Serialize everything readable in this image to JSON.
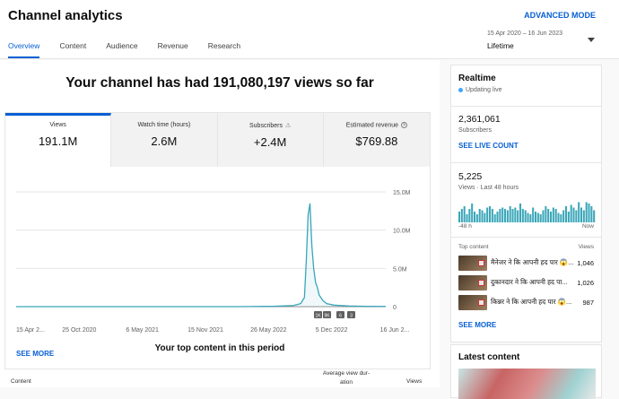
{
  "header": {
    "title": "Channel analytics",
    "advanced_mode": "ADVANCED MODE",
    "tabs": [
      {
        "label": "Overview",
        "active": true
      },
      {
        "label": "Content",
        "active": false
      },
      {
        "label": "Audience",
        "active": false
      },
      {
        "label": "Revenue",
        "active": false
      },
      {
        "label": "Research",
        "active": false
      }
    ],
    "date_range": "15 Apr 2020 – 16 Jun 2023",
    "date_selection": "Lifetime"
  },
  "main": {
    "headline": "Your channel has had 191,080,197 views so far",
    "metrics": [
      {
        "label": "Views",
        "value": "191.1M"
      },
      {
        "label": "Watch time (hours)",
        "value": "2.6M"
      },
      {
        "label": "Subscribers",
        "value": "+2.4M"
      },
      {
        "label": "Estimated revenue",
        "value": "$769.88"
      }
    ],
    "see_more": "SEE MORE",
    "top_content_title": "Your top content in this period",
    "table_headers": {
      "content": "Content",
      "avg_view_duration_1": "Average view dur-",
      "avg_view_duration_2": "ation",
      "views": "Views"
    }
  },
  "chart_data": {
    "type": "line",
    "x_tick_labels": [
      "15 Apr 2...",
      "25 Oct 2020",
      "6 May 2021",
      "15 Nov 2021",
      "26 May 2022",
      "5 Dec 2022",
      "16 Jun 2..."
    ],
    "y_tick_labels": [
      "15.0M",
      "10.0M",
      "5.0M",
      "0"
    ],
    "ylim": [
      0,
      15000000
    ],
    "series": [
      {
        "x_position": [
          0,
          0.1,
          0.2,
          0.3,
          0.4,
          0.5,
          0.6,
          0.7,
          0.75,
          0.77,
          0.78,
          0.785,
          0.79,
          0.795,
          0.8,
          0.805,
          0.81,
          0.815,
          0.82,
          0.83,
          0.84,
          0.86,
          0.9,
          0.95,
          1.0
        ],
        "values": [
          0,
          0,
          0,
          0,
          0,
          0,
          0,
          50000,
          150000,
          400000,
          1200000,
          6000000,
          12000000,
          13500000,
          8000000,
          5000000,
          3200000,
          2500000,
          1500000,
          800000,
          400000,
          200000,
          80000,
          40000,
          20000
        ]
      }
    ],
    "event_markers": [
      "1K",
      "9K",
      "6",
      "3"
    ],
    "color": "#3aa6b9"
  },
  "realtime": {
    "title": "Realtime",
    "status": "Updating live",
    "subscribers": "2,361,061",
    "subscribers_label": "Subscribers",
    "see_live_count": "SEE LIVE COUNT",
    "views": "5,225",
    "views_label": "Views · Last 48 hours",
    "bar_axis_start": "-48 h",
    "bar_axis_end": "Now",
    "bars": [
      0.4,
      0.5,
      0.6,
      0.3,
      0.5,
      0.7,
      0.4,
      0.3,
      0.5,
      0.45,
      0.35,
      0.55,
      0.6,
      0.5,
      0.3,
      0.4,
      0.5,
      0.55,
      0.5,
      0.45,
      0.6,
      0.5,
      0.55,
      0.45,
      0.7,
      0.5,
      0.45,
      0.35,
      0.3,
      0.55,
      0.4,
      0.35,
      0.3,
      0.45,
      0.6,
      0.5,
      0.4,
      0.55,
      0.5,
      0.35,
      0.3,
      0.45,
      0.6,
      0.4,
      0.65,
      0.55,
      0.45,
      0.75,
      0.55,
      0.45,
      0.75,
      0.7,
      0.6,
      0.45
    ],
    "top_content_label": "Top content",
    "views_col_label": "Views",
    "items": [
      {
        "title": "मैनेजर ने कि आपनी हद पार 😱...",
        "views": "1,046"
      },
      {
        "title": "दुकानदार ने कि आपनी हद पा...",
        "views": "1,026"
      },
      {
        "title": "किन्नर ने कि आपनी हद पार 😱...",
        "views": "987"
      }
    ],
    "see_more": "SEE MORE"
  },
  "latest": {
    "title": "Latest content"
  }
}
